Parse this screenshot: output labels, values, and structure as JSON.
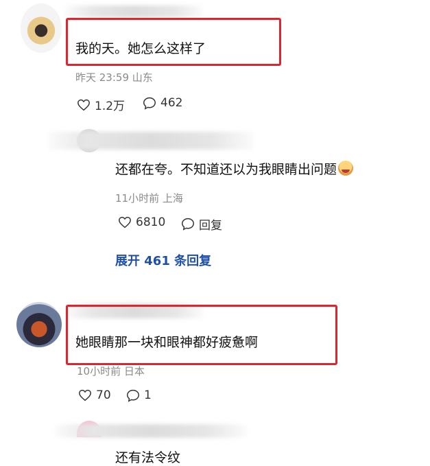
{
  "comments": [
    {
      "text": "我的天。她怎么这样了",
      "meta": "昨天 23:59 山东",
      "likes": "1.2万",
      "replies": "462"
    },
    {
      "text": "还都在夸。不知道还以为我眼睛出问题",
      "meta": "11小时前 上海",
      "likes": "6810",
      "reply_label": "回复",
      "expand_label": "展开 461 条回复"
    },
    {
      "text": "她眼睛那一块和眼神都好疲惫啊",
      "meta": "10小时前 日本",
      "likes": "70",
      "replies": "1"
    },
    {
      "text": "还有法令纹"
    }
  ],
  "colors": {
    "highlight_box": "#e0242f",
    "expand_link": "#1f4ea8",
    "meta_text": "#8a8a8a"
  },
  "icons": [
    "heart-icon",
    "comment-bubble-icon",
    "crying-face-emoji"
  ]
}
